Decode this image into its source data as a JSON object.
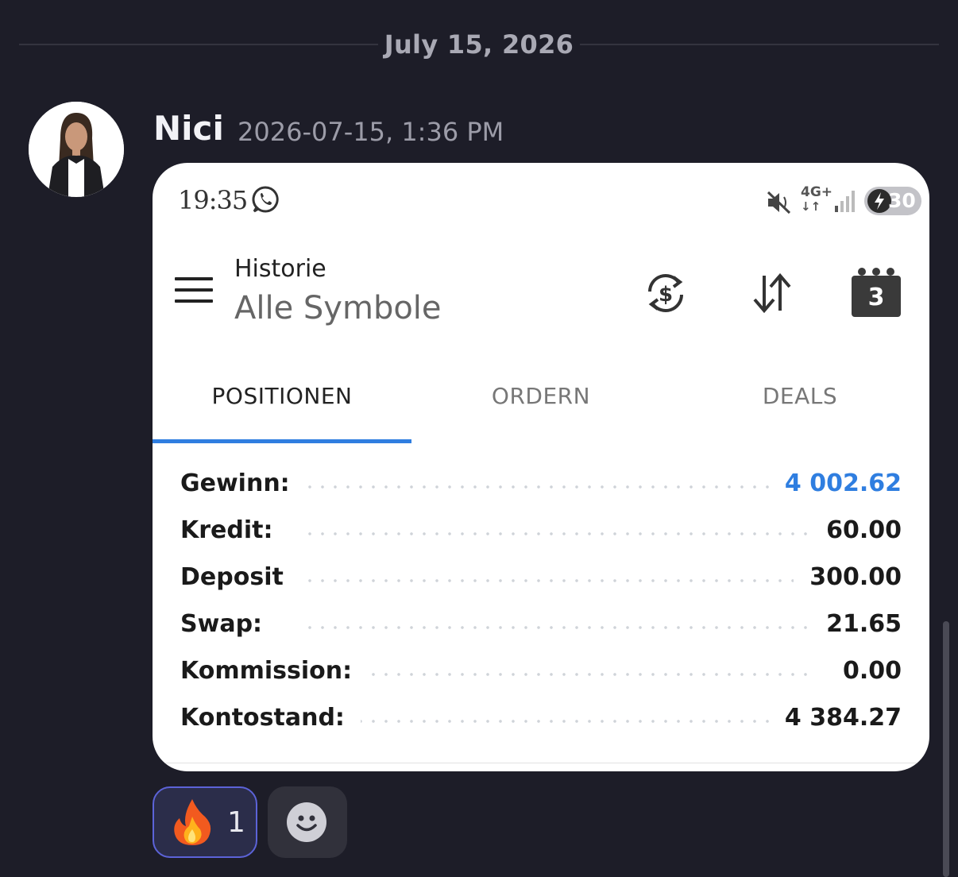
{
  "divider": {
    "date": "July 15, 2026"
  },
  "message": {
    "author": "Nici",
    "timestamp": "2026-07-15, 1:36 PM"
  },
  "screenshot": {
    "status_bar": {
      "time": "19:35",
      "network": "4G+",
      "battery": "30"
    },
    "app_bar": {
      "title": "Historie",
      "subtitle": "Alle Symbole",
      "calendar_day": "3"
    },
    "tabs": [
      {
        "label": "POSITIONEN",
        "active": true
      },
      {
        "label": "ORDERN",
        "active": false
      },
      {
        "label": "DEALS",
        "active": false
      }
    ],
    "rows": [
      {
        "label": "Gewinn:",
        "value": "4 002.62",
        "highlight": true
      },
      {
        "label": "Kredit:",
        "value": "60.00"
      },
      {
        "label": "Deposit",
        "value": "300.00"
      },
      {
        "label": "Swap:",
        "value": "21.65"
      },
      {
        "label": "Kommission:",
        "value": "0.00"
      },
      {
        "label": "Kontostand:",
        "value": "4 384.27"
      }
    ],
    "accent_color": "#2f7ee0"
  },
  "reactions": [
    {
      "emoji": "fire-icon",
      "count": "1",
      "selected": true
    }
  ],
  "icons": [
    "whatsapp-icon",
    "mute-icon",
    "signal-icon",
    "battery-icon",
    "menu-icon",
    "currency-exchange-icon",
    "sort-icon",
    "calendar-icon",
    "fire-icon",
    "add-reaction-icon"
  ]
}
